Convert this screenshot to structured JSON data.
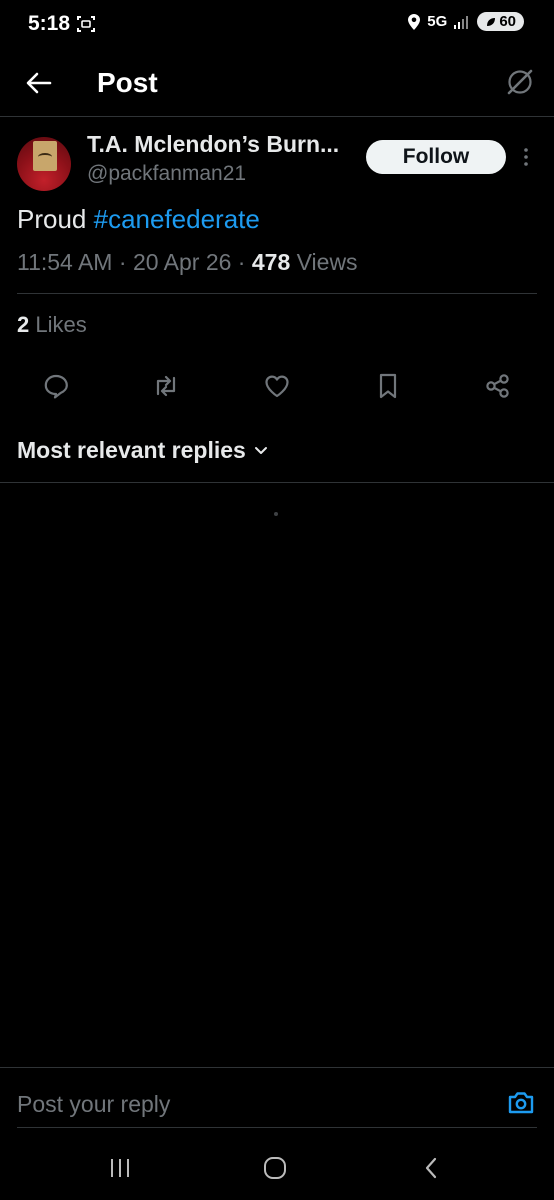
{
  "status_bar": {
    "time": "5:18",
    "network": "5G",
    "battery": "60"
  },
  "header": {
    "title": "Post"
  },
  "post": {
    "author": {
      "display_name": "T.A. Mclendon’s Burn...",
      "handle": "@packfanman21"
    },
    "follow_label": "Follow",
    "text_plain": "Proud ",
    "hashtag": "#canefederate",
    "time": "11:54 AM",
    "date": "20 Apr 26",
    "views_count": "478",
    "views_label": "Views",
    "likes_count": "2",
    "likes_label": "Likes"
  },
  "actions": [
    {
      "name": "reply",
      "icon": "reply-icon"
    },
    {
      "name": "repost",
      "icon": "repost-icon"
    },
    {
      "name": "like",
      "icon": "heart-icon"
    },
    {
      "name": "bookmark",
      "icon": "bookmark-icon"
    },
    {
      "name": "share",
      "icon": "share-icon"
    }
  ],
  "replies": {
    "sort_label": "Most relevant replies"
  },
  "composer": {
    "placeholder": "Post your reply"
  },
  "colors": {
    "background": "#000000",
    "accent": "#1d9bf0",
    "secondary_text": "#71767b",
    "divider": "#2f3336"
  }
}
